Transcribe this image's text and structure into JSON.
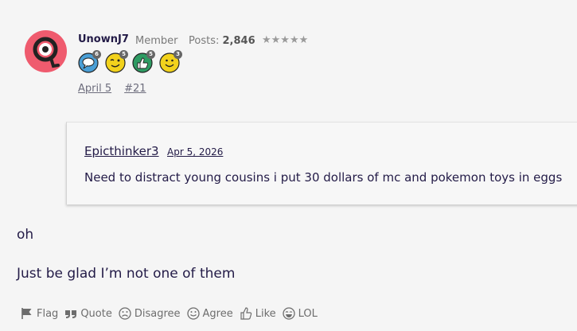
{
  "user": {
    "name": "UnownJ7",
    "role": "Member",
    "posts_label": "Posts:",
    "posts_count": "2,846",
    "stars": "★★★★★",
    "badges": [
      {
        "icon": "speech-bubble-icon",
        "count": "6",
        "color": "#4a9fd6"
      },
      {
        "icon": "wink-face-icon",
        "count": "5",
        "color": "#f2d21c"
      },
      {
        "icon": "thumbs-up-icon",
        "count": "5",
        "color": "#2e9b63"
      },
      {
        "icon": "smile-face-icon",
        "count": "3",
        "color": "#f2d21c"
      }
    ]
  },
  "post_meta": {
    "date": "April 5",
    "number": "#21"
  },
  "quote": {
    "author": "Epicthinker3",
    "date": "Apr 5, 2026",
    "text": "Need to distract young cousins i put 30 dollars of mc and pokemon toys in eggs"
  },
  "body": {
    "line1": "oh",
    "line2": "Just be glad I’m not one of them"
  },
  "actions": {
    "flag": "Flag",
    "quote": "Quote",
    "disagree": "Disagree",
    "agree": "Agree",
    "like": "Like",
    "lol": "LOL"
  }
}
